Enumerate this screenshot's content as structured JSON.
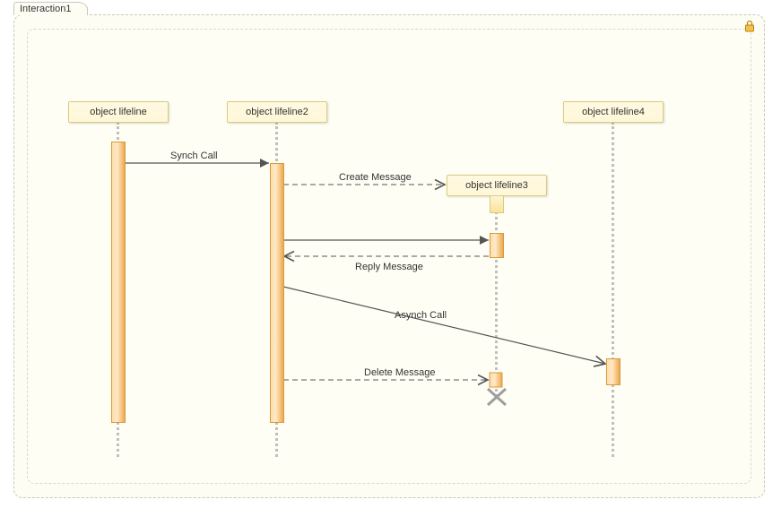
{
  "frame": {
    "title": "Interaction1"
  },
  "lifelines": {
    "l1": "object lifeline",
    "l2": "object lifeline2",
    "l3": "object lifeline3",
    "l4": "object lifeline4"
  },
  "messages": {
    "synch": "Synch Call",
    "create": "Create Message",
    "reply": "Reply Message",
    "asynch": "Asynch Call",
    "delete": "Delete Message"
  },
  "chart_data": {
    "type": "sequence-diagram",
    "frame": "Interaction1",
    "lifelines": [
      {
        "id": "L1",
        "name": "object lifeline"
      },
      {
        "id": "L2",
        "name": "object lifeline2"
      },
      {
        "id": "L3",
        "name": "object lifeline3",
        "created_by": "m2",
        "destroyed_by": "m6"
      },
      {
        "id": "L4",
        "name": "object lifeline4"
      }
    ],
    "messages": [
      {
        "id": "m1",
        "from": "L1",
        "to": "L2",
        "type": "synchronous",
        "label": "Synch Call"
      },
      {
        "id": "m2",
        "from": "L2",
        "to": "L3",
        "type": "create",
        "label": "Create Message"
      },
      {
        "id": "m3",
        "from": "L2",
        "to": "L3",
        "type": "synchronous",
        "label": ""
      },
      {
        "id": "m4",
        "from": "L3",
        "to": "L2",
        "type": "reply",
        "label": "Reply Message"
      },
      {
        "id": "m5",
        "from": "L2",
        "to": "L4",
        "type": "asynchronous",
        "label": "Asynch Call"
      },
      {
        "id": "m6",
        "from": "L2",
        "to": "L3",
        "type": "delete",
        "label": "Delete Message"
      }
    ]
  }
}
